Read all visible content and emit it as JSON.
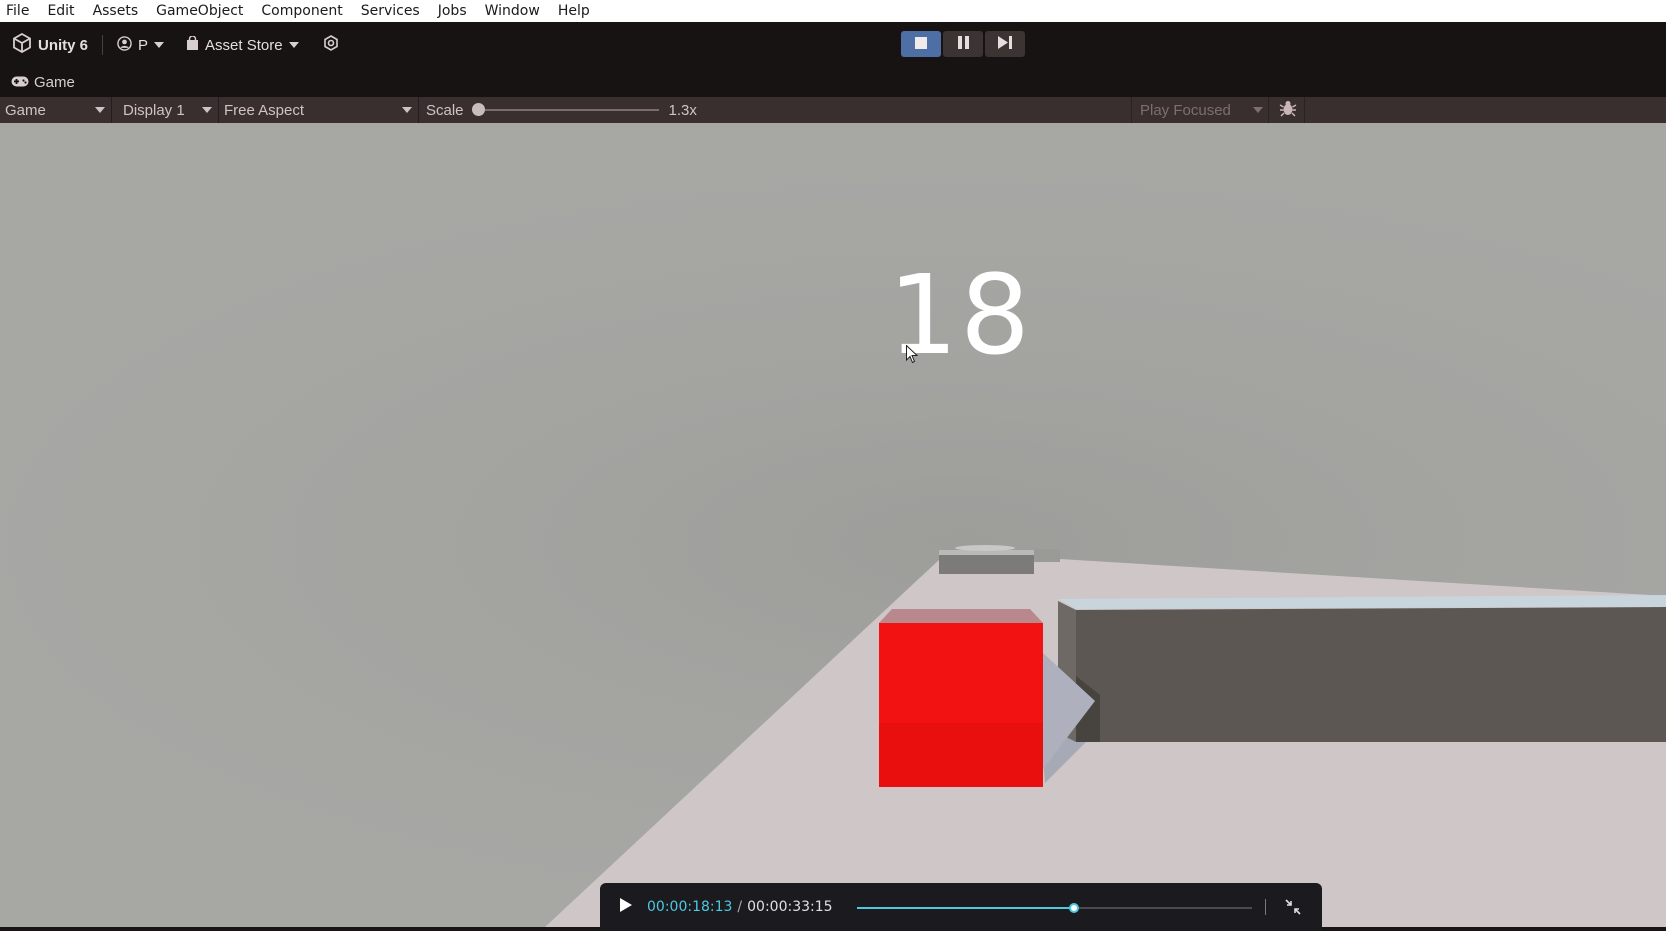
{
  "menu": [
    "File",
    "Edit",
    "Assets",
    "GameObject",
    "Component",
    "Services",
    "Jobs",
    "Window",
    "Help"
  ],
  "toolbar": {
    "unity_label": "Unity 6",
    "account_label": "P",
    "asset_store_label": "Asset Store",
    "play_state": "playing"
  },
  "tab": {
    "label": "Game"
  },
  "game_toolbar": {
    "view_mode": "Game",
    "display": "Display 1",
    "aspect": "Free Aspect",
    "scale_label": "Scale",
    "scale_value": "1.3x",
    "scale_slider_position": 0.0,
    "play_mode": "Play Focused"
  },
  "game": {
    "score": "18",
    "colors": {
      "player_cube": "#f21212",
      "floor": "#cfc6c8",
      "wall": "#5f5a55",
      "sky": "#a5a5a2"
    }
  },
  "video": {
    "current_time": "00:00:18:13",
    "separator": "/",
    "total_time": "00:00:33:15",
    "progress": 0.55,
    "accent": "#4fc8e0"
  }
}
